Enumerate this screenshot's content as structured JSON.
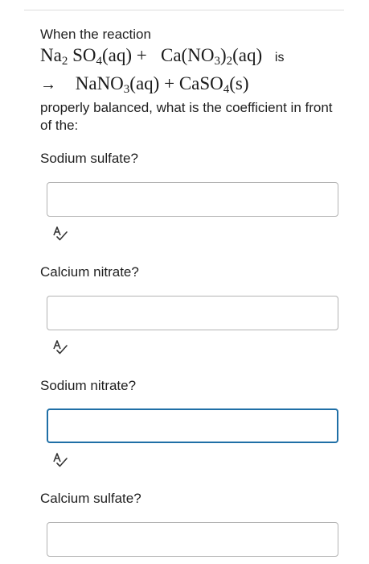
{
  "question": {
    "intro": "When the reaction",
    "equation": {
      "reactant1": {
        "el1": "Na",
        "sub1": "2",
        "el2": "SO",
        "sub2": "4",
        "state": "(aq)"
      },
      "plus": "+",
      "reactant2": {
        "el1": "Ca(NO",
        "sub1": "3",
        "close": ")",
        "sub2": "2",
        "state": "(aq)"
      },
      "is_word": "is",
      "arrow": "→",
      "product1": {
        "el1": "NaNO",
        "sub1": "3",
        "state": "(aq)"
      },
      "plus2": "+",
      "product2": {
        "el1": "CaSO",
        "sub1": "4",
        "state": "(s)"
      }
    },
    "prompt": "properly balanced, what is the coefficient in front of the:"
  },
  "parts": [
    {
      "label": "Sodium sulfate?",
      "value": "",
      "icon": "spellcheck-icon"
    },
    {
      "label": "Calcium nitrate?",
      "value": "",
      "icon": "spellcheck-icon"
    },
    {
      "label": "Sodium nitrate?",
      "value": "",
      "icon": "spellcheck-icon"
    },
    {
      "label": "Calcium sulfate?",
      "value": "",
      "icon": "spellcheck-icon"
    }
  ],
  "colors": {
    "focus_border": "#1f6fa6",
    "box_border": "#b3b3b3"
  }
}
